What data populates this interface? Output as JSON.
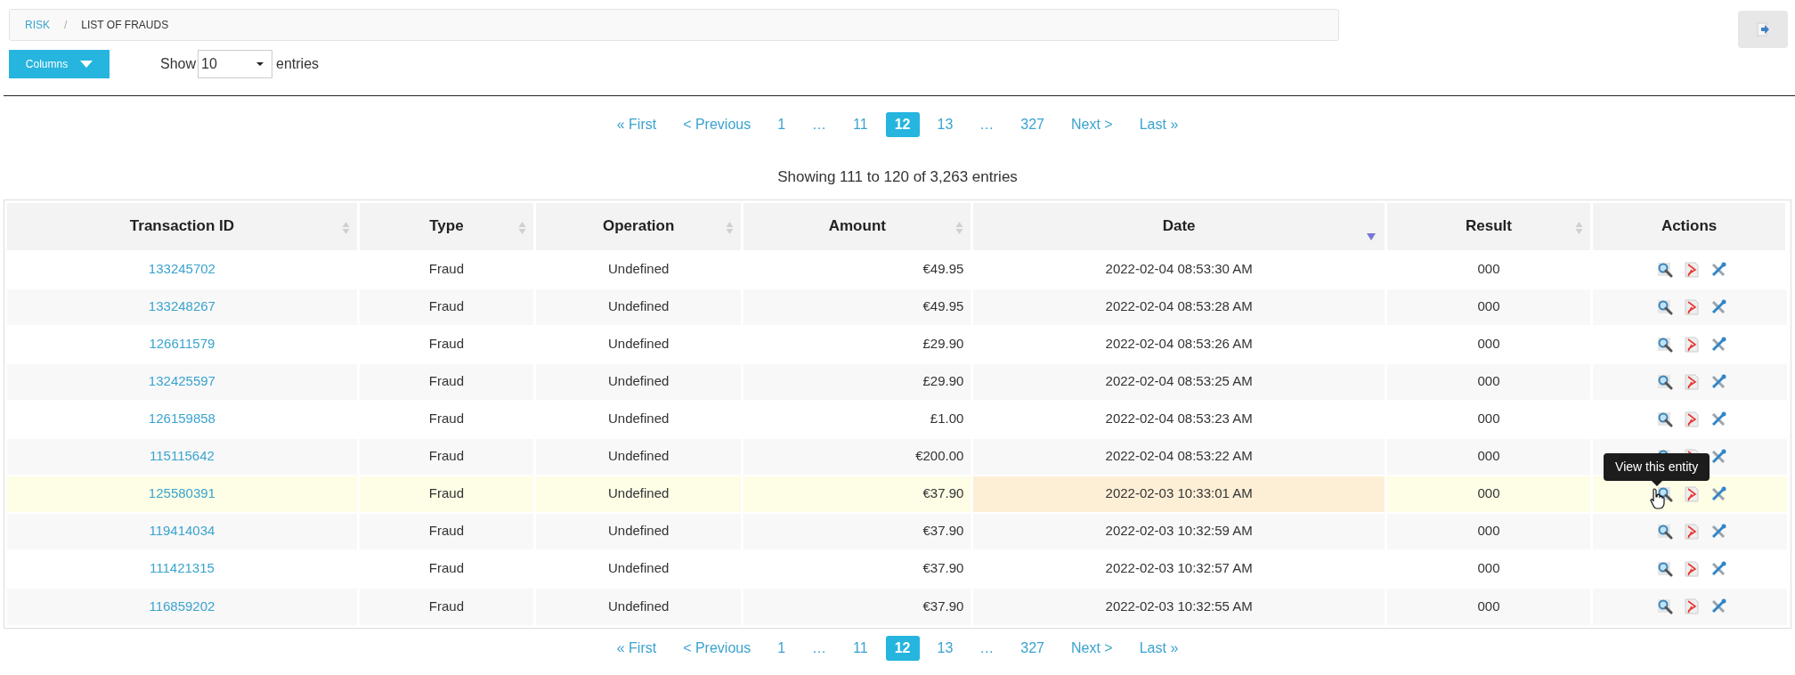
{
  "breadcrumb": [
    {
      "label": "RISK",
      "kind": "link"
    },
    {
      "label": "/",
      "kind": "separator"
    },
    {
      "label": "LIST OF FRAUDS",
      "kind": "current"
    }
  ],
  "columns_button": {
    "label": "Columns"
  },
  "length": {
    "before": "Show",
    "value": "10",
    "after": "entries"
  },
  "pagination_top": [
    {
      "label": "« First",
      "selected": false
    },
    {
      "label": "< Previous",
      "selected": false
    },
    {
      "label": "1",
      "selected": false
    },
    {
      "label": "…",
      "selected": false
    },
    {
      "label": "11",
      "selected": false
    },
    {
      "label": "12",
      "selected": true
    },
    {
      "label": "13",
      "selected": false
    },
    {
      "label": "…",
      "selected": false
    },
    {
      "label": "327",
      "selected": false
    },
    {
      "label": "Next >",
      "selected": false
    },
    {
      "label": "Last »",
      "selected": false
    }
  ],
  "info": "Showing 111 to 120 of 3,263 entries",
  "table": {
    "columns": [
      {
        "label": "Transaction ID",
        "sorted": false
      },
      {
        "label": "Type",
        "sorted": false
      },
      {
        "label": "Operation",
        "sorted": false
      },
      {
        "label": "Amount",
        "sorted": false
      },
      {
        "label": "Date",
        "sorted": true
      },
      {
        "label": "Result",
        "sorted": false
      },
      {
        "label": "Actions"
      }
    ],
    "rows": [
      {
        "id": "133245702",
        "type": "Fraud",
        "operation": "Undefined",
        "amount": "€49.95",
        "date": "2022-02-04 08:53:30 AM",
        "result": "000",
        "hovered": false
      },
      {
        "id": "133248267",
        "type": "Fraud",
        "operation": "Undefined",
        "amount": "€49.95",
        "date": "2022-02-04 08:53:28 AM",
        "result": "000",
        "hovered": false
      },
      {
        "id": "126611579",
        "type": "Fraud",
        "operation": "Undefined",
        "amount": "£29.90",
        "date": "2022-02-04 08:53:26 AM",
        "result": "000",
        "hovered": false
      },
      {
        "id": "132425597",
        "type": "Fraud",
        "operation": "Undefined",
        "amount": "£29.90",
        "date": "2022-02-04 08:53:25 AM",
        "result": "000",
        "hovered": false
      },
      {
        "id": "126159858",
        "type": "Fraud",
        "operation": "Undefined",
        "amount": "£1.00",
        "date": "2022-02-04 08:53:23 AM",
        "result": "000",
        "hovered": false
      },
      {
        "id": "115115642",
        "type": "Fraud",
        "operation": "Undefined",
        "amount": "€200.00",
        "date": "2022-02-04 08:53:22 AM",
        "result": "000",
        "hovered": false
      },
      {
        "id": "125580391",
        "type": "Fraud",
        "operation": "Undefined",
        "amount": "€37.90",
        "date": "2022-02-03 10:33:01 AM",
        "result": "000",
        "hovered": true,
        "tooltip": "View this entity"
      },
      {
        "id": "119414034",
        "type": "Fraud",
        "operation": "Undefined",
        "amount": "€37.90",
        "date": "2022-02-03 10:32:59 AM",
        "result": "000",
        "hovered": false
      },
      {
        "id": "111421315",
        "type": "Fraud",
        "operation": "Undefined",
        "amount": "€37.90",
        "date": "2022-02-03 10:32:57 AM",
        "result": "000",
        "hovered": false
      },
      {
        "id": "116859202",
        "type": "Fraud",
        "operation": "Undefined",
        "amount": "€37.90",
        "date": "2022-02-03 10:32:55 AM",
        "result": "000",
        "hovered": false
      }
    ]
  },
  "pagination_bottom": [
    {
      "label": "« First",
      "selected": false
    },
    {
      "label": "< Previous",
      "selected": false
    },
    {
      "label": "1",
      "selected": false
    },
    {
      "label": "…",
      "selected": false
    },
    {
      "label": "11",
      "selected": false
    },
    {
      "label": "12",
      "selected": true
    },
    {
      "label": "13",
      "selected": false
    },
    {
      "label": "…",
      "selected": false
    },
    {
      "label": "327",
      "selected": false
    },
    {
      "label": "Next >",
      "selected": false
    },
    {
      "label": "Last »",
      "selected": false
    }
  ]
}
